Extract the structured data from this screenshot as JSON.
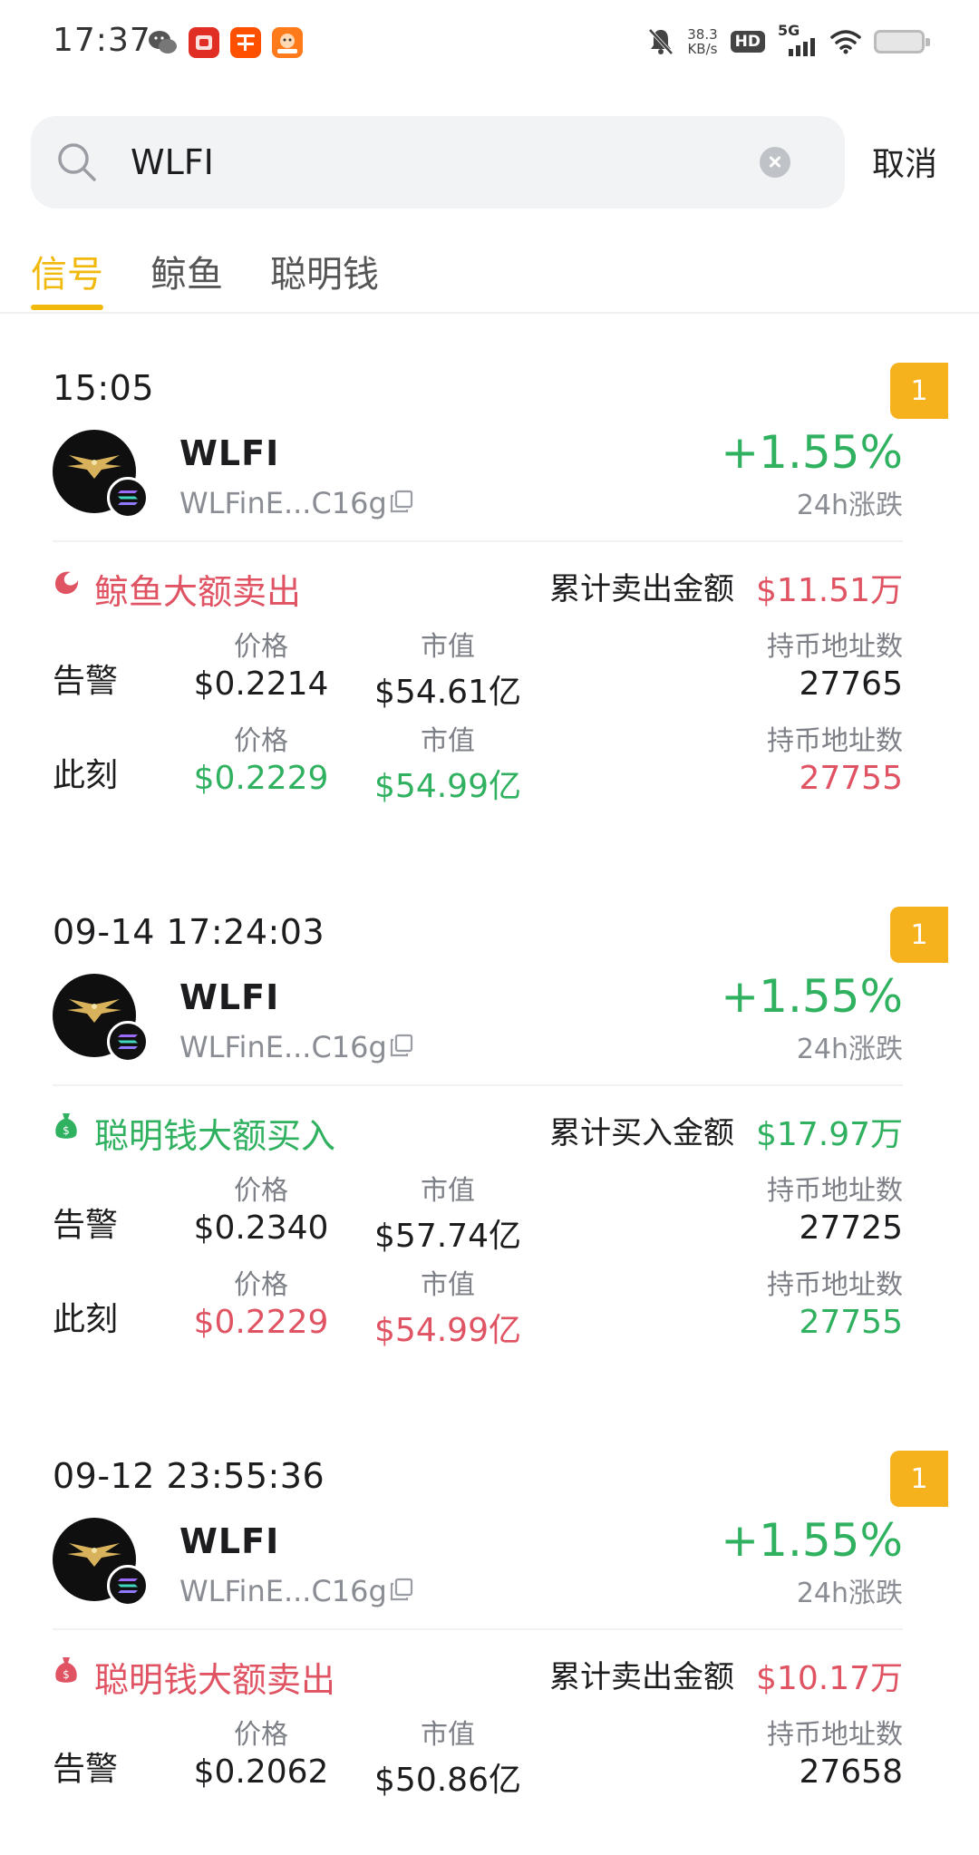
{
  "status_bar": {
    "time": "17:37",
    "speed_value": "38.3",
    "speed_unit": "KB/s",
    "hd": "HD",
    "network": "5G",
    "icons": [
      "wechat-icon",
      "pinduoduo-icon",
      "taobao-icon",
      "app-icon",
      "mute-icon",
      "wifi-icon",
      "battery-icon"
    ]
  },
  "search": {
    "value": "WLFI",
    "placeholder": "",
    "cancel_label": "取消"
  },
  "tabs": [
    {
      "label": "信号",
      "active": true
    },
    {
      "label": "鲸鱼",
      "active": false
    },
    {
      "label": "聪明钱",
      "active": false
    }
  ],
  "colors": {
    "accent": "#f0b90b",
    "up": "#2fb160",
    "down": "#e05363",
    "badge": "#f5b21c"
  },
  "cards": [
    {
      "time": "15:05",
      "rank": "1",
      "token": {
        "name": "WLFI",
        "address": "WLFinE...C16g",
        "change": "+1.55%",
        "change_label": "24h涨跌"
      },
      "signal": {
        "icon": "whale-icon",
        "text": "鲸鱼大额卖出",
        "tone": "red",
        "sum_label": "累计卖出金额",
        "sum_value": "$11.51万"
      },
      "alert": {
        "label": "告警",
        "price_label": "价格",
        "price": "$0.2214",
        "mcap_label": "市值",
        "mcap": "$54.61亿",
        "holders_label": "持币地址数",
        "holders": "27765"
      },
      "now": {
        "label": "此刻",
        "price_label": "价格",
        "price": "$0.2229",
        "mcap_label": "市值",
        "mcap": "$54.99亿",
        "holders_label": "持币地址数",
        "holders": "27755"
      }
    },
    {
      "time": "09-14 17:24:03",
      "rank": "1",
      "token": {
        "name": "WLFI",
        "address": "WLFinE...C16g",
        "change": "+1.55%",
        "change_label": "24h涨跌"
      },
      "signal": {
        "icon": "money-bag-icon",
        "text": "聪明钱大额买入",
        "tone": "green",
        "sum_label": "累计买入金额",
        "sum_value": "$17.97万"
      },
      "alert": {
        "label": "告警",
        "price_label": "价格",
        "price": "$0.2340",
        "mcap_label": "市值",
        "mcap": "$57.74亿",
        "holders_label": "持币地址数",
        "holders": "27725"
      },
      "now": {
        "label": "此刻",
        "price_label": "价格",
        "price": "$0.2229",
        "mcap_label": "市值",
        "mcap": "$54.99亿",
        "holders_label": "持币地址数",
        "holders": "27755"
      }
    },
    {
      "time": "09-12 23:55:36",
      "rank": "1",
      "token": {
        "name": "WLFI",
        "address": "WLFinE...C16g",
        "change": "+1.55%",
        "change_label": "24h涨跌"
      },
      "signal": {
        "icon": "money-bag-icon",
        "text": "聪明钱大额卖出",
        "tone": "red",
        "sum_label": "累计卖出金额",
        "sum_value": "$10.17万"
      },
      "alert": {
        "label": "告警",
        "price_label": "价格",
        "price": "$0.2062",
        "mcap_label": "市值",
        "mcap": "$50.86亿",
        "holders_label": "持币地址数",
        "holders": "27658"
      }
    }
  ]
}
